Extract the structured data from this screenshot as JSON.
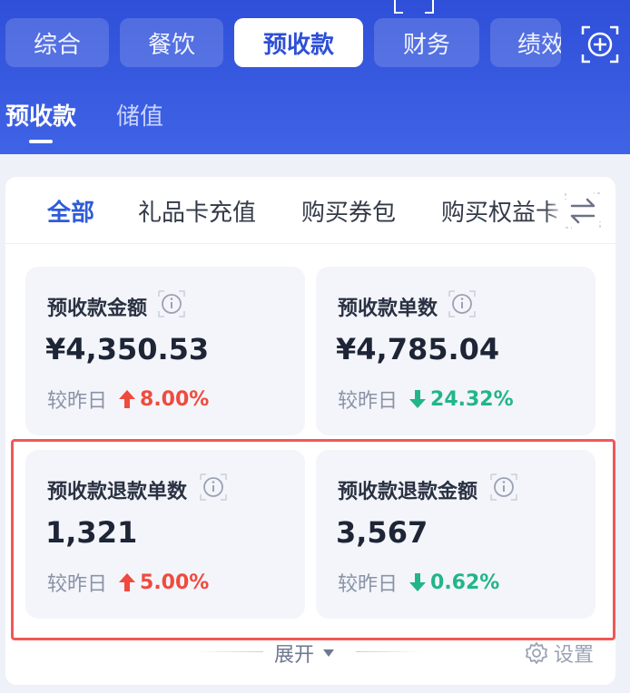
{
  "top_tabs": [
    {
      "label": "综合"
    },
    {
      "label": "餐饮"
    },
    {
      "label": "预收款"
    },
    {
      "label": "财务"
    },
    {
      "label": "绩效"
    }
  ],
  "sub_tabs": [
    {
      "label": "预收款"
    },
    {
      "label": "储值"
    }
  ],
  "filters": [
    {
      "label": "全部"
    },
    {
      "label": "礼品卡充值"
    },
    {
      "label": "购买券包"
    },
    {
      "label": "购买权益卡"
    }
  ],
  "metrics": [
    {
      "label": "预收款金额",
      "value": "¥4,350.53",
      "compare_label": "较昨日",
      "delta": "8.00%",
      "direction": "up"
    },
    {
      "label": "预收款单数",
      "value": "¥4,785.04",
      "compare_label": "较昨日",
      "delta": "24.32%",
      "direction": "down"
    },
    {
      "label": "预收款退款单数",
      "value": "1,321",
      "compare_label": "较昨日",
      "delta": "5.00%",
      "direction": "up"
    },
    {
      "label": "预收款退款金额",
      "value": "3,567",
      "compare_label": "较昨日",
      "delta": "0.62%",
      "direction": "down"
    }
  ],
  "footer": {
    "expand_label": "展开",
    "settings_label": "设置"
  },
  "colors": {
    "header_blue": "#3a5ce4",
    "active_blue": "#2e5cd8",
    "up_red": "#f04a3e",
    "down_green": "#22b58a",
    "highlight_red": "#f25757"
  },
  "icons": {
    "add": "add-square-icon",
    "switch": "swap-arrows-icon",
    "info": "info-icon",
    "up": "arrow-up-icon",
    "down": "arrow-down-icon",
    "expand": "caret-down-icon",
    "settings": "gear-icon"
  }
}
